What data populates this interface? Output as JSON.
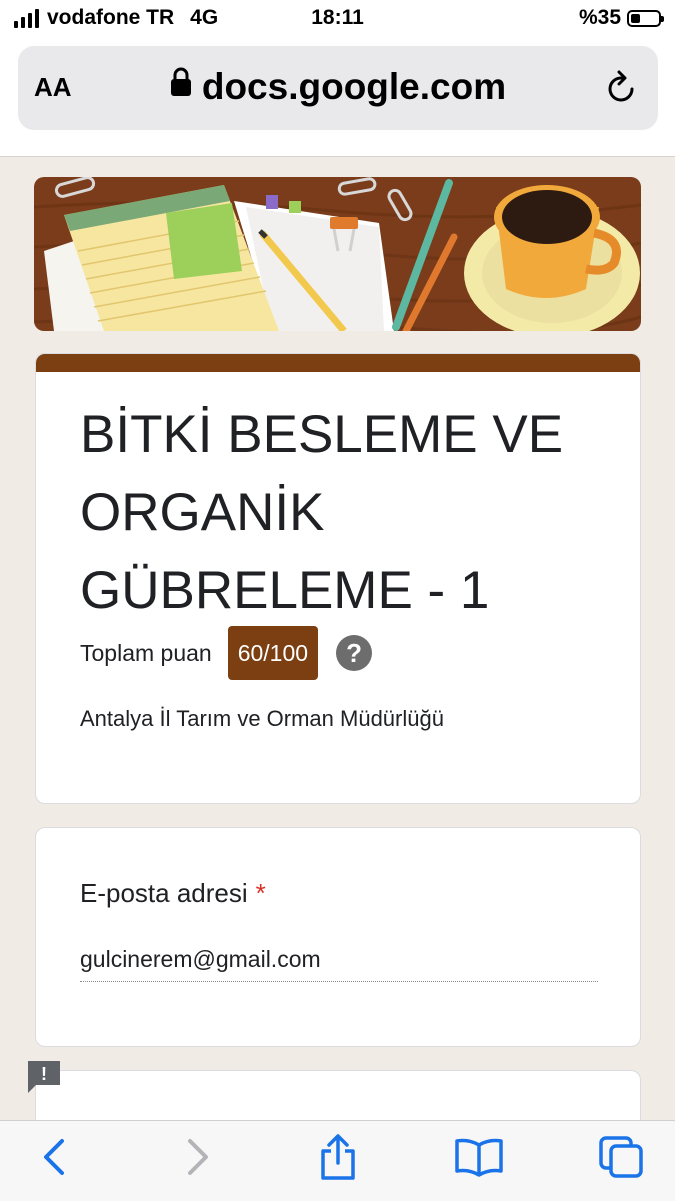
{
  "status_bar": {
    "carrier": "vodafone TR",
    "network": "4G",
    "time": "18:11",
    "battery_percent_text": "%35",
    "battery_level": 0.35
  },
  "browser": {
    "text_size_button": "AA",
    "url": "docs.google.com",
    "icons": [
      "lock-icon",
      "reload-icon",
      "back-icon",
      "forward-icon",
      "share-icon",
      "bookmarks-icon",
      "tabs-icon"
    ]
  },
  "form": {
    "title": "BİTKİ BESLEME VE ORGANİK GÜBRELEME - 1",
    "score_label": "Toplam puan",
    "score": "60/100",
    "help_icon_text": "?",
    "organization": "Antalya İl Tarım ve Orman Müdürlüğü",
    "email_label": "E-posta adresi",
    "required_marker": "*",
    "email_value": "gulcinerem@gmail.com",
    "report_icon_text": "!"
  },
  "colors": {
    "theme": "#7b3f12",
    "background": "#f0ebe5",
    "required": "#d93025",
    "ios_blue": "#1a73e8"
  }
}
